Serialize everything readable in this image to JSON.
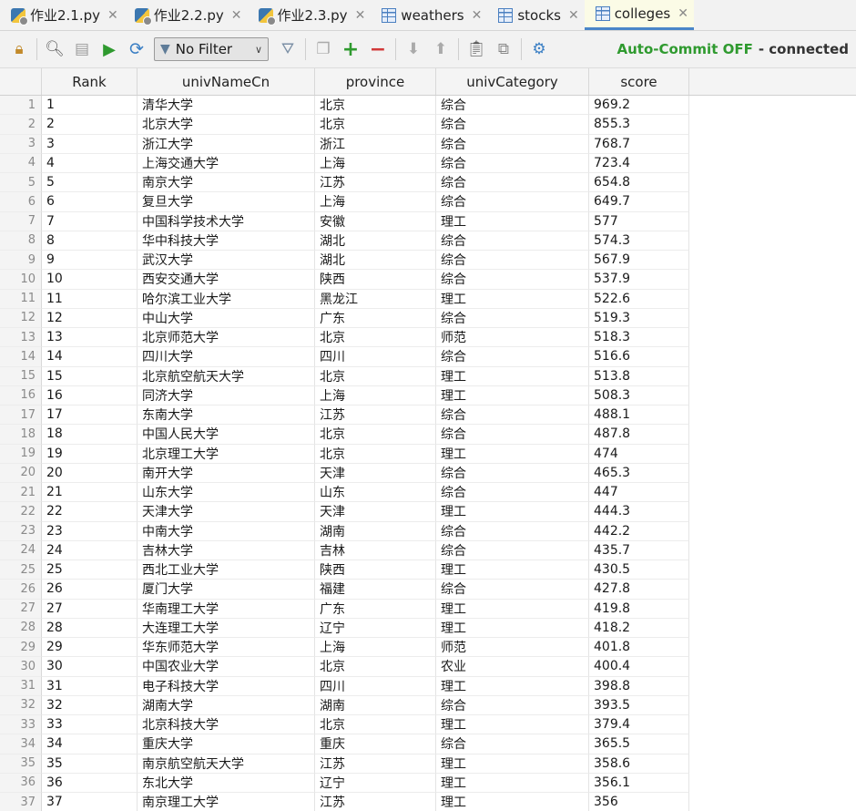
{
  "tabs": [
    {
      "label": "作业2.1.py",
      "type": "py",
      "active": false
    },
    {
      "label": "作业2.2.py",
      "type": "py",
      "active": false
    },
    {
      "label": "作业2.3.py",
      "type": "py",
      "active": false
    },
    {
      "label": "weathers",
      "type": "table",
      "active": false
    },
    {
      "label": "stocks",
      "type": "table",
      "active": false
    },
    {
      "label": "colleges",
      "type": "table",
      "active": true
    }
  ],
  "toolbar": {
    "filter_label": "No Filter",
    "autocommit": "Auto-Commit OFF",
    "connection": "- connected"
  },
  "columns": [
    "Rank",
    "univNameCn",
    "province",
    "univCategory",
    "score"
  ],
  "rows": [
    [
      "1",
      "清华大学",
      "北京",
      "综合",
      "969.2"
    ],
    [
      "2",
      "北京大学",
      "北京",
      "综合",
      "855.3"
    ],
    [
      "3",
      "浙江大学",
      "浙江",
      "综合",
      "768.7"
    ],
    [
      "4",
      "上海交通大学",
      "上海",
      "综合",
      "723.4"
    ],
    [
      "5",
      "南京大学",
      "江苏",
      "综合",
      "654.8"
    ],
    [
      "6",
      "复旦大学",
      "上海",
      "综合",
      "649.7"
    ],
    [
      "7",
      "中国科学技术大学",
      "安徽",
      "理工",
      "577"
    ],
    [
      "8",
      "华中科技大学",
      "湖北",
      "综合",
      "574.3"
    ],
    [
      "9",
      "武汉大学",
      "湖北",
      "综合",
      "567.9"
    ],
    [
      "10",
      "西安交通大学",
      "陕西",
      "综合",
      "537.9"
    ],
    [
      "11",
      "哈尔滨工业大学",
      "黑龙江",
      "理工",
      "522.6"
    ],
    [
      "12",
      "中山大学",
      "广东",
      "综合",
      "519.3"
    ],
    [
      "13",
      "北京师范大学",
      "北京",
      "师范",
      "518.3"
    ],
    [
      "14",
      "四川大学",
      "四川",
      "综合",
      "516.6"
    ],
    [
      "15",
      "北京航空航天大学",
      "北京",
      "理工",
      "513.8"
    ],
    [
      "16",
      "同济大学",
      "上海",
      "理工",
      "508.3"
    ],
    [
      "17",
      "东南大学",
      "江苏",
      "综合",
      "488.1"
    ],
    [
      "18",
      "中国人民大学",
      "北京",
      "综合",
      "487.8"
    ],
    [
      "19",
      "北京理工大学",
      "北京",
      "理工",
      "474"
    ],
    [
      "20",
      "南开大学",
      "天津",
      "综合",
      "465.3"
    ],
    [
      "21",
      "山东大学",
      "山东",
      "综合",
      "447"
    ],
    [
      "22",
      "天津大学",
      "天津",
      "理工",
      "444.3"
    ],
    [
      "23",
      "中南大学",
      "湖南",
      "综合",
      "442.2"
    ],
    [
      "24",
      "吉林大学",
      "吉林",
      "综合",
      "435.7"
    ],
    [
      "25",
      "西北工业大学",
      "陕西",
      "理工",
      "430.5"
    ],
    [
      "26",
      "厦门大学",
      "福建",
      "综合",
      "427.8"
    ],
    [
      "27",
      "华南理工大学",
      "广东",
      "理工",
      "419.8"
    ],
    [
      "28",
      "大连理工大学",
      "辽宁",
      "理工",
      "418.2"
    ],
    [
      "29",
      "华东师范大学",
      "上海",
      "师范",
      "401.8"
    ],
    [
      "30",
      "中国农业大学",
      "北京",
      "农业",
      "400.4"
    ],
    [
      "31",
      "电子科技大学",
      "四川",
      "理工",
      "398.8"
    ],
    [
      "32",
      "湖南大学",
      "湖南",
      "综合",
      "393.5"
    ],
    [
      "33",
      "北京科技大学",
      "北京",
      "理工",
      "379.4"
    ],
    [
      "34",
      "重庆大学",
      "重庆",
      "综合",
      "365.5"
    ],
    [
      "35",
      "南京航空航天大学",
      "江苏",
      "理工",
      "358.6"
    ],
    [
      "36",
      "东北大学",
      "辽宁",
      "理工",
      "356.1"
    ],
    [
      "37",
      "南京理工大学",
      "江苏",
      "理工",
      "356"
    ]
  ]
}
